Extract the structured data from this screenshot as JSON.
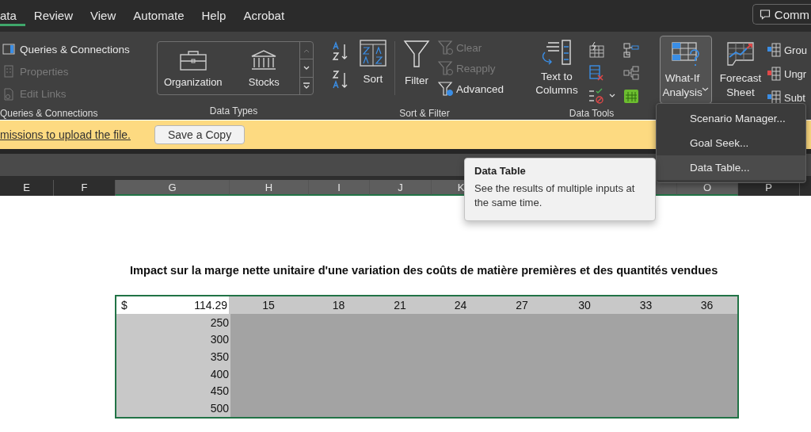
{
  "menu_tabs": [
    {
      "label": "ata",
      "selected": true
    },
    {
      "label": "Review",
      "selected": false
    },
    {
      "label": "View",
      "selected": false
    },
    {
      "label": "Automate",
      "selected": false
    },
    {
      "label": "Help",
      "selected": false
    },
    {
      "label": "Acrobat",
      "selected": false
    }
  ],
  "comments_button": "Comm",
  "ribbon": {
    "queries": {
      "items": [
        {
          "label": "Queries & Connections",
          "disabled": false
        },
        {
          "label": "Properties",
          "disabled": true
        },
        {
          "label": "Edit Links",
          "disabled": true
        }
      ],
      "group_label": "Queries & Connections"
    },
    "data_types": {
      "items": [
        "Organization",
        "Stocks"
      ],
      "group_label": "Data Types"
    },
    "sort_filter": {
      "sort": "Sort",
      "filter": "Filter",
      "items": [
        {
          "label": "Clear",
          "disabled": true
        },
        {
          "label": "Reapply",
          "disabled": true
        },
        {
          "label": "Advanced",
          "disabled": false
        }
      ],
      "group_label": "Sort & Filter"
    },
    "data_tools": {
      "text_to_columns": "Text to Columns",
      "group_label": "Data Tools"
    },
    "forecast": {
      "what_if": "What-If Analysis",
      "what_if_expanded": true,
      "forecast_sheet": "Forecast Sheet"
    },
    "outline": {
      "items": [
        "Grou",
        "Ungr",
        "Subt"
      ]
    }
  },
  "notification": {
    "link": "missions to upload the file.",
    "button": "Save a Copy"
  },
  "column_headers": [
    {
      "label": "E",
      "selected": false
    },
    {
      "label": "F",
      "selected": false
    },
    {
      "label": "G",
      "selected": true
    },
    {
      "label": "H",
      "selected": true
    },
    {
      "label": "I",
      "selected": true
    },
    {
      "label": "J",
      "selected": true
    },
    {
      "label": "K",
      "selected": true
    },
    {
      "label": "O",
      "selected": true
    },
    {
      "label": "P",
      "selected": false
    }
  ],
  "sheet": {
    "title": "Impact sur la marge nette unitaire d'une variation des coûts de matière premières et des quantités vendues",
    "data_table": {
      "currency": "$",
      "corner_value": "114.29",
      "column_inputs": [
        "15",
        "18",
        "21",
        "24",
        "27",
        "30",
        "33",
        "36"
      ],
      "row_inputs": [
        "250",
        "300",
        "350",
        "400",
        "450",
        "500"
      ]
    }
  },
  "dropdown_menu": {
    "items": [
      {
        "label": "Scenario Manager...",
        "selected": false
      },
      {
        "label": "Goal Seek...",
        "selected": false
      },
      {
        "label": "Data Table...",
        "selected": true
      }
    ]
  },
  "tooltip": {
    "title": "Data Table",
    "text": "See the results of multiple inputs at the same time."
  }
}
